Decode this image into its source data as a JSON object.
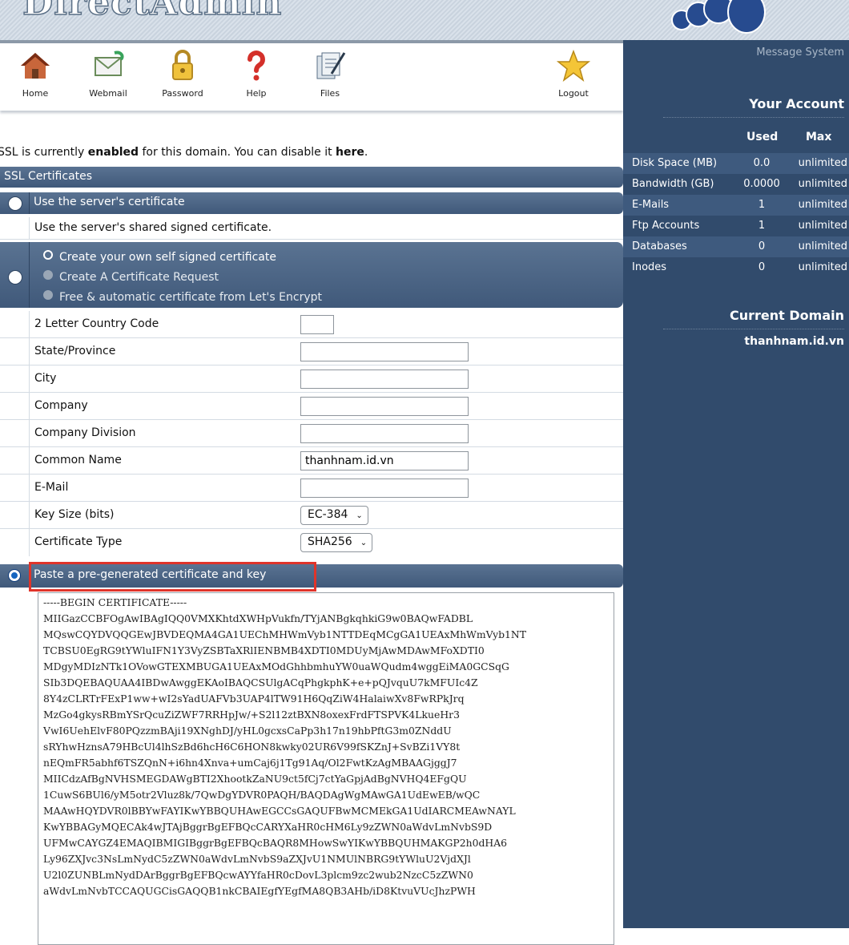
{
  "banner": {
    "brand": "DirectAdmin"
  },
  "toolbar": [
    {
      "label": "Home",
      "icon": "house-icon"
    },
    {
      "label": "Webmail",
      "icon": "envelope-icon"
    },
    {
      "label": "Password",
      "icon": "padlock-icon"
    },
    {
      "label": "Help",
      "icon": "question-icon"
    },
    {
      "label": "Files",
      "icon": "files-icon"
    },
    {
      "label": "Logout",
      "icon": "star-icon"
    }
  ],
  "status": {
    "prefix": "SSL is currently ",
    "state": "enabled",
    "middle": " for this domain. You can disable it ",
    "link": "here",
    "suffix": "."
  },
  "ssl_header": "SSL Certificates",
  "option_server": "Use the server's certificate",
  "option_server_desc": "Use the server's shared signed certificate.",
  "options_generate": [
    "Create your own self signed certificate",
    "Create A Certificate Request",
    "Free & automatic certificate from Let's Encrypt"
  ],
  "form": {
    "country": {
      "label": "2 Letter Country Code",
      "value": ""
    },
    "state": {
      "label": "State/Province",
      "value": ""
    },
    "city": {
      "label": "City",
      "value": ""
    },
    "company": {
      "label": "Company",
      "value": ""
    },
    "division": {
      "label": "Company Division",
      "value": ""
    },
    "common_name": {
      "label": "Common Name",
      "value": "thanhnam.id.vn"
    },
    "email": {
      "label": "E-Mail",
      "value": ""
    },
    "key_size": {
      "label": "Key Size (bits)",
      "value": "EC-384"
    },
    "cert_type": {
      "label": "Certificate Type",
      "value": "SHA256"
    }
  },
  "option_paste": "Paste a pre-generated certificate and key",
  "certificate_text": "-----BEGIN CERTIFICATE-----\nMIIGazCCBFOgAwIBAgIQQ0VMXKhtdXWHpVukfn/TYjANBgkqhkiG9w0BAQwFADBL\nMQswCQYDVQQGEwJBVDEQMA4GA1UEChMHWmVyb1NTTDEqMCgGA1UEAxMhWmVyb1NT\nTCBSU0EgRG9tYWluIFN1Y3VyZSBTaXRlIENBMB4XDTI0MDUyMjAwMDAwMFoXDTI0\nMDgyMDIzNTk1OVowGTEXMBUGA1UEAxMOdGhhbmhuYW0uaWQudm4wggEiMA0GCSqG\nSIb3DQEBAQUAA4IBDwAwggEKAoIBAQCSUlgACqPhgkphK+e+pQJvquU7kMFUIc4Z\n8Y4zCLRTrFExP1ww+wI2sYadUAFVb3UAP4lTW91H6QqZiW4HalaiwXv8FwRPkJrq\nMzGo4gkysRBmYSrQcuZiZWF7RRHpJw/+S2l12ztBXN8oxexFrdFTSPVK4LkueHr3\nVwI6UehElvF80PQzzmBAji19XNghDJ/yHL0gcxsCaPp3h17n19hbPftG3m0ZNddU\nsRYhwHznsA79HBcUl4lhSzBd6hcH6C6HON8kwky02UR6V99fSKZnJ+SvBZi1VY8t\nnEQmFR5abhf6TSZQnN+i6hn4Xnva+umCaj6j1Tg91Aq/Ol2FwtKzAgMBAAGjggJ7\nMIICdzAfBgNVHSMEGDAWgBTI2XhootkZaNU9ct5fCj7ctYaGpjAdBgNVHQ4EFgQU\n1CuwS6BUl6/yM5otr2Vluz8k/7QwDgYDVR0PAQH/BAQDAgWgMAwGA1UdEwEB/wQC\nMAAwHQYDVR0lBBYwFAYIKwYBBQUHAwEGCCsGAQUFBwMCMEkGA1UdIARCMEAwNAYL\nKwYBBAGyMQECAk4wJTAjBggrBgEFBQcCARYXaHR0cHM6Ly9zZWN0aWdvLmNvbS9D\nUFMwCAYGZ4EMAQIBMIGIBggrBgEFBQcBAQR8MHowSwYIKwYBBQUHMAKGP2h0dHA6\nLy96ZXJvc3NsLmNydC5zZWN0aWdvLmNvbS9aZXJvU1NMUlNBRG9tYWluU2VjdXJl\nU2l0ZUNBLmNydDArBggrBgEFBQcwAYYfaHR0cDovL3plcm9zc2wub2NzcC5zZWN0\naWdvLmNvbTCCAQUGCisGAQQB1nkCBAIEgfYEgfMA8QB3AHb/iD8KtvuVUcJhzPWH",
  "sidebar": {
    "message_system": "Message System",
    "your_account": "Your Account",
    "col_used": "Used",
    "col_max": "Max",
    "rows": [
      {
        "label": "Disk Space (MB)",
        "used": "0.0",
        "max": "unlimited"
      },
      {
        "label": "Bandwidth (GB)",
        "used": "0.0000",
        "max": "unlimited"
      },
      {
        "label": "E-Mails",
        "used": "1",
        "max": "unlimited"
      },
      {
        "label": "Ftp Accounts",
        "used": "1",
        "max": "unlimited"
      },
      {
        "label": "Databases",
        "used": "0",
        "max": "unlimited"
      },
      {
        "label": "Inodes",
        "used": "0",
        "max": "unlimited"
      }
    ],
    "current_domain_title": "Current Domain",
    "current_domain": "thanhnam.id.vn"
  },
  "colors": {
    "bar": "#4d6788",
    "sidebar": "#314b6c",
    "highlight": "#e0342a",
    "radio_selected": "#1565c0"
  }
}
